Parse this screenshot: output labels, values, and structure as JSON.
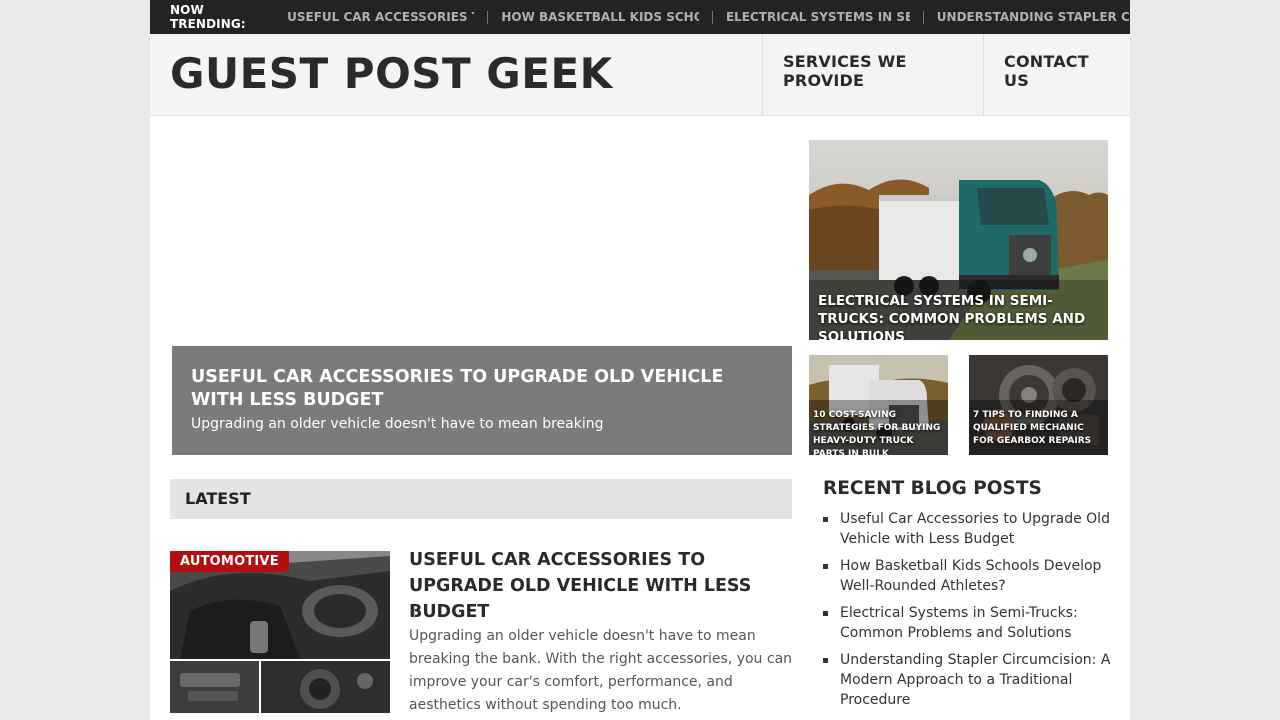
{
  "trending": {
    "label": "NOW TRENDING:",
    "items": [
      "USEFUL CAR ACCESSORIES T...",
      "HOW BASKETBALL KIDS SCHO...",
      "ELECTRICAL SYSTEMS IN SE...",
      "UNDERSTANDING STAPLER CI..."
    ]
  },
  "header": {
    "site_title": "GUEST POST GEEK",
    "nav": [
      "SERVICES WE PROVIDE",
      "CONTACT US"
    ]
  },
  "featured": {
    "main": {
      "title": "USEFUL CAR ACCESSORIES TO UPGRADE OLD VEHICLE WITH LESS BUDGET",
      "excerpt": "Upgrading an older vehicle doesn't have to mean breaking"
    },
    "right": {
      "title": "ELECTRICAL SYSTEMS IN SEMI-TRUCKS: COMMON PROBLEMS AND SOLUTIONS"
    },
    "small": [
      {
        "title": "10 COST-SAVING STRATEGIES FOR BUYING HEAVY-DUTY TRUCK PARTS IN BULK"
      },
      {
        "title": "7 TIPS TO FINDING A QUALIFIED MECHANIC FOR GEARBOX REPAIRS"
      }
    ]
  },
  "latest": {
    "heading": "LATEST",
    "post": {
      "category": "AUTOMOTIVE",
      "title": "USEFUL CAR ACCESSORIES TO UPGRADE OLD VEHICLE WITH LESS BUDGET",
      "excerpt": "Upgrading an older vehicle doesn't have to mean breaking the bank. With the right accessories, you can improve your car's comfort, performance, and aesthetics without spending too much."
    }
  },
  "sidebar": {
    "recent_title": "RECENT BLOG POSTS",
    "recent_posts": [
      "Useful Car Accessories to Upgrade Old Vehicle with Less Budget",
      "How Basketball Kids Schools Develop Well-Rounded Athletes?",
      "Electrical Systems in Semi-Trucks: Common Problems and Solutions",
      "Understanding Stapler Circumcision: A Modern Approach to a Traditional Procedure"
    ]
  },
  "colors": {
    "trending_bg": "#232323",
    "header_bg": "#f4f4f4",
    "category_badge": "#b40f0f",
    "featured_overlay": "#7b7b7b",
    "latest_bar": "#e4e4e4"
  }
}
